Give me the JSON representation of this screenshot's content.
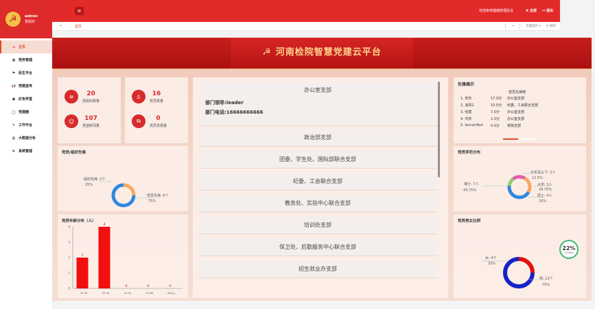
{
  "brand": {
    "logo_glyph": "☭",
    "username": "admin",
    "role": "党组织"
  },
  "sidebar": {
    "items": [
      {
        "label": "主页",
        "icon": "home-icon",
        "glyph": "⌂",
        "active": true
      },
      {
        "label": "党务管理",
        "icon": "grid-icon",
        "glyph": "▦",
        "active": false
      },
      {
        "label": "民生平台",
        "icon": "flag-icon",
        "glyph": "⚑",
        "active": false
      },
      {
        "label": "党建宣传",
        "icon": "megaphone-icon",
        "glyph": "📢",
        "active": false
      },
      {
        "label": "红色学堂",
        "icon": "book-icon",
        "glyph": "▣",
        "active": false
      },
      {
        "label": "党建圈",
        "icon": "chat-icon",
        "glyph": "◯",
        "active": false
      },
      {
        "label": "工作平台",
        "icon": "edit-icon",
        "glyph": "✎",
        "active": false
      },
      {
        "label": "大数据分析",
        "icon": "bar-chart-icon",
        "glyph": "▥",
        "active": false
      },
      {
        "label": "系统管理",
        "icon": "gear-icon",
        "glyph": "⚙",
        "active": false
      }
    ]
  },
  "header": {
    "menu_glyph": "≡",
    "welcome": "欢迎来到楚鹿管理后台",
    "fullscreen_label": "✖ 全屏",
    "logout_label": "↦ 退出",
    "tab_home": "首页",
    "tab_prev": "⇤",
    "tab_next": "⇥",
    "page_ops": "页面操作 ▾",
    "refresh": "⟳ 刷新"
  },
  "banner": {
    "emblem": "☭",
    "title": "河南检院智慧党建云平台"
  },
  "stats": [
    {
      "value": "20",
      "label": "党组织数量",
      "icon": "layers-icon",
      "glyph": "≋"
    },
    {
      "value": "16",
      "label": "党员数量",
      "icon": "user-icon",
      "glyph": "♙"
    },
    {
      "value": "107",
      "label": "党建新闻量",
      "icon": "user-circle-icon",
      "glyph": "☺"
    },
    {
      "value": "0",
      "label": "党员发展量",
      "icon": "share-icon",
      "glyph": "⧉"
    }
  ],
  "pioneer_chart": {
    "title": "党员/组织先锋",
    "slices": [
      {
        "label": "组织先锋: 2个",
        "pct": "25%",
        "value": 2,
        "color": "#f7a860"
      },
      {
        "label": "党员先锋: 6个",
        "pct": "75%",
        "value": 6,
        "color": "#2f88e0"
      }
    ]
  },
  "age_chart": {
    "title": "党员年龄分布（人）",
    "chart_data": {
      "type": "bar",
      "categories": [
        "20-30",
        "31-40",
        "41-50",
        "51-60",
        "60以上"
      ],
      "values": [
        2,
        4,
        0,
        0,
        0
      ],
      "ylim": [
        0,
        4
      ],
      "yticks": [
        0,
        1,
        2,
        3,
        4
      ],
      "color": "#f20f0f"
    }
  },
  "departments": {
    "first": {
      "name": "办公室支部",
      "leader": "部门领导:leader",
      "phone": "部门电话:16666666666"
    },
    "others": [
      "政治部支部",
      "团委、学生处、国际部联合支部",
      "纪委、工会联合支部",
      "教务处、实验中心联合支部",
      "培训处支部",
      "保卫处、后勤服务中心联合支部",
      "招生就业办支部"
    ]
  },
  "vanguard": {
    "title": "先锋展示",
    "header": "党员先锋榜",
    "rows": [
      {
        "name": "1. 张天",
        "score": "17.0分",
        "dept": "办公室支部"
      },
      {
        "name": "2. 凌风1",
        "score": "10.0分",
        "dept": "纪委、工会联合支部"
      },
      {
        "name": "3. 怡宸",
        "score": "7.0分",
        "dept": "办公室支部"
      },
      {
        "name": "4. 刘庆",
        "score": "1.0分",
        "dept": "办公室支部"
      },
      {
        "name": "5. lenconTest",
        "score": "0.0分",
        "dept": "校院支部"
      }
    ]
  },
  "edu_chart": {
    "title": "党员学历分布",
    "slices": [
      {
        "label": "博士: 7人",
        "pct": "43.75%",
        "value": 7,
        "color": "#2f88e0"
      },
      {
        "label": "大专及以下: 2人",
        "pct": "12.5%",
        "value": 2,
        "color": "#8fcf6a"
      },
      {
        "label": "大学: 3人",
        "pct": "18.75%",
        "value": 3,
        "color": "#e65ea8"
      },
      {
        "label": "硕士: 4人",
        "pct": "25%",
        "value": 4,
        "color": "#f7a860"
      }
    ]
  },
  "gender_chart": {
    "title": "党员男女比例",
    "slices": [
      {
        "label": "女: 4个",
        "pct": "25%",
        "value": 4,
        "color": "#e3110d"
      },
      {
        "label": "男: 12个",
        "pct": "75%",
        "value": 12,
        "color": "#1523c8"
      }
    ]
  },
  "speed_widget": {
    "value": "22%",
    "sub": "↑0.6K/s"
  }
}
